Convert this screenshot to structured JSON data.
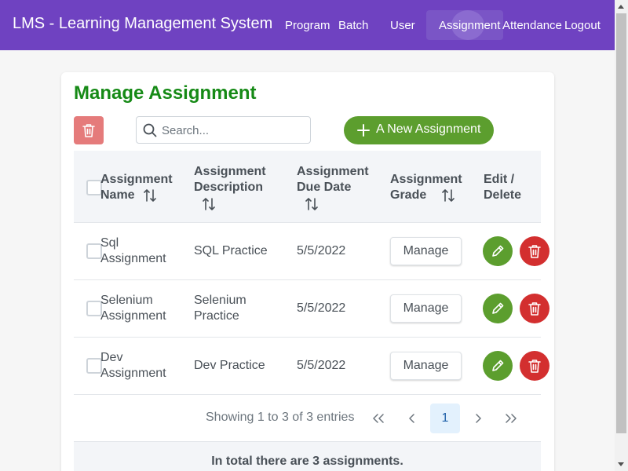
{
  "app": {
    "title": "LMS - Learning Management System",
    "nav": [
      "Program",
      "Batch",
      "User",
      "Assignment",
      "Attendance",
      "Logout"
    ],
    "active_nav": "Assignment",
    "colors": {
      "header": "#6f42c1",
      "title_green": "#168a16",
      "action_green": "#5c9e2e",
      "danger_red": "#d32f2f"
    }
  },
  "page": {
    "title": "Manage Assignment",
    "search_placeholder": "Search...",
    "new_button_label": "A New Assignment",
    "new_button_icon": "plus-icon",
    "delete_all_icon": "trash-icon"
  },
  "table": {
    "headers": {
      "name": [
        "Assignment",
        "Name"
      ],
      "description": [
        "Assignment",
        "Description"
      ],
      "due_date": [
        "Assignment",
        "Due Date"
      ],
      "grade": [
        "Assignment",
        "Grade"
      ],
      "actions": [
        "Edit /",
        "Delete"
      ]
    },
    "manage_label": "Manage",
    "rows": [
      {
        "name": [
          "Sql",
          "Assignment"
        ],
        "description": [
          "SQL Practice"
        ],
        "due_date": "5/5/2022"
      },
      {
        "name": [
          "Selenium",
          "Assignment"
        ],
        "description": [
          "Selenium",
          "Practice"
        ],
        "due_date": "5/5/2022"
      },
      {
        "name": [
          "Dev",
          "Assignment"
        ],
        "description": [
          "Dev Practice"
        ],
        "due_date": "5/5/2022"
      }
    ]
  },
  "paginator": {
    "summary": "Showing 1 to 3 of 3 entries",
    "current_page": "1",
    "first": "«",
    "prev": "‹",
    "next": "›",
    "last": "»"
  },
  "footer": {
    "summary": "In total there are 3 assignments."
  }
}
